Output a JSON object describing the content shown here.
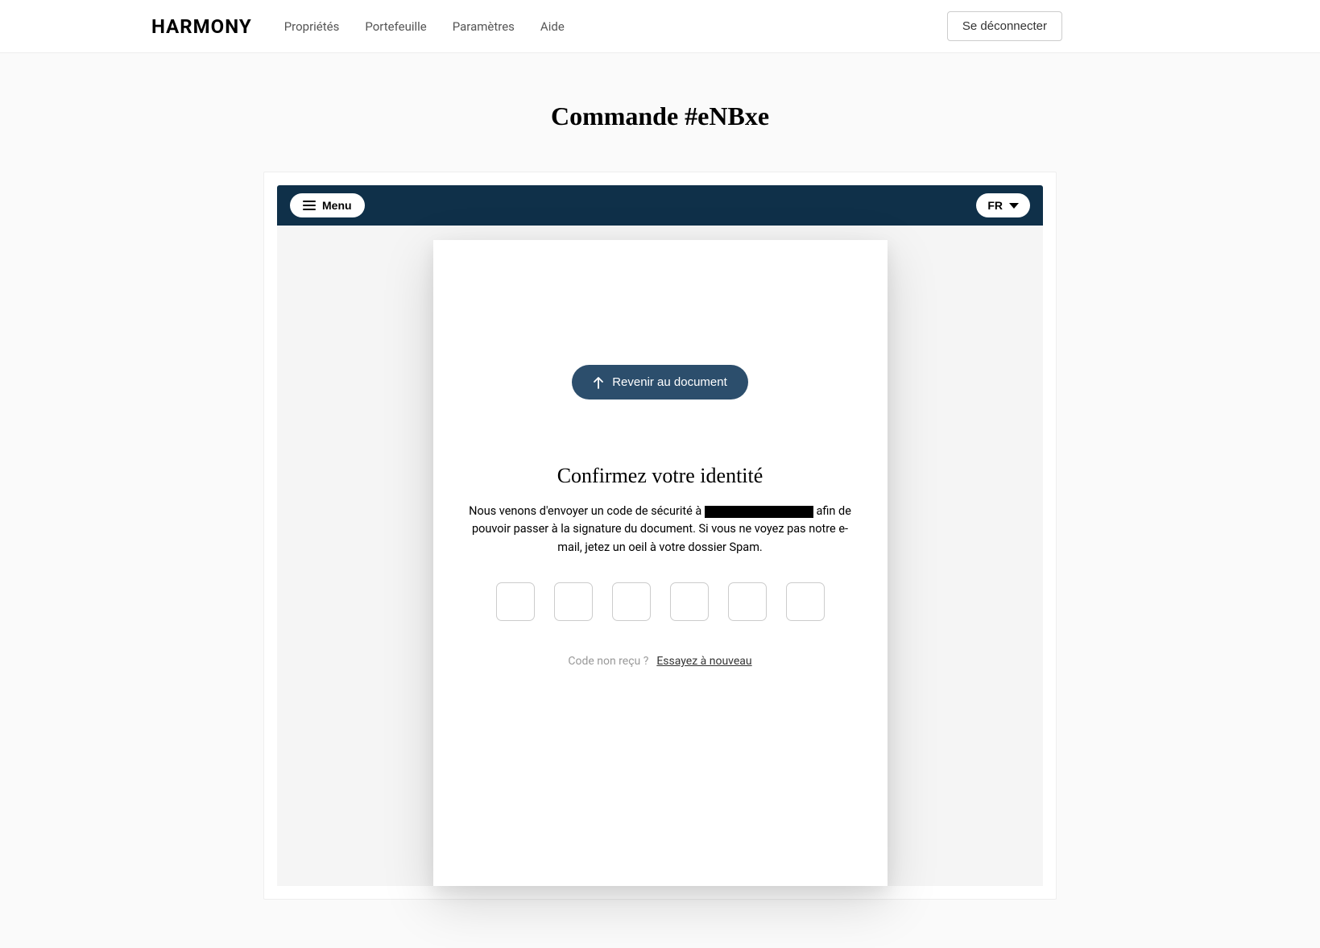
{
  "header": {
    "logo": "HARMONY",
    "nav": {
      "properties": "Propriétés",
      "portfolio": "Portefeuille",
      "settings": "Paramètres",
      "help": "Aide"
    },
    "logout": "Se déconnecter"
  },
  "page": {
    "title": "Commande #eNBxe"
  },
  "embed": {
    "menu_label": "Menu",
    "lang_label": "FR",
    "return_label": "Revenir au document",
    "confirm_title": "Confirmez votre identité",
    "confirm_text_before": "Nous venons d'envoyer un code de sécurité à ",
    "confirm_text_after": " afin de pouvoir passer à la signature du document. Si vous ne voyez pas notre e-mail, jetez un oeil à votre dossier Spam.",
    "resend_question": "Code non reçu ?",
    "resend_link": "Essayez à nouveau"
  }
}
